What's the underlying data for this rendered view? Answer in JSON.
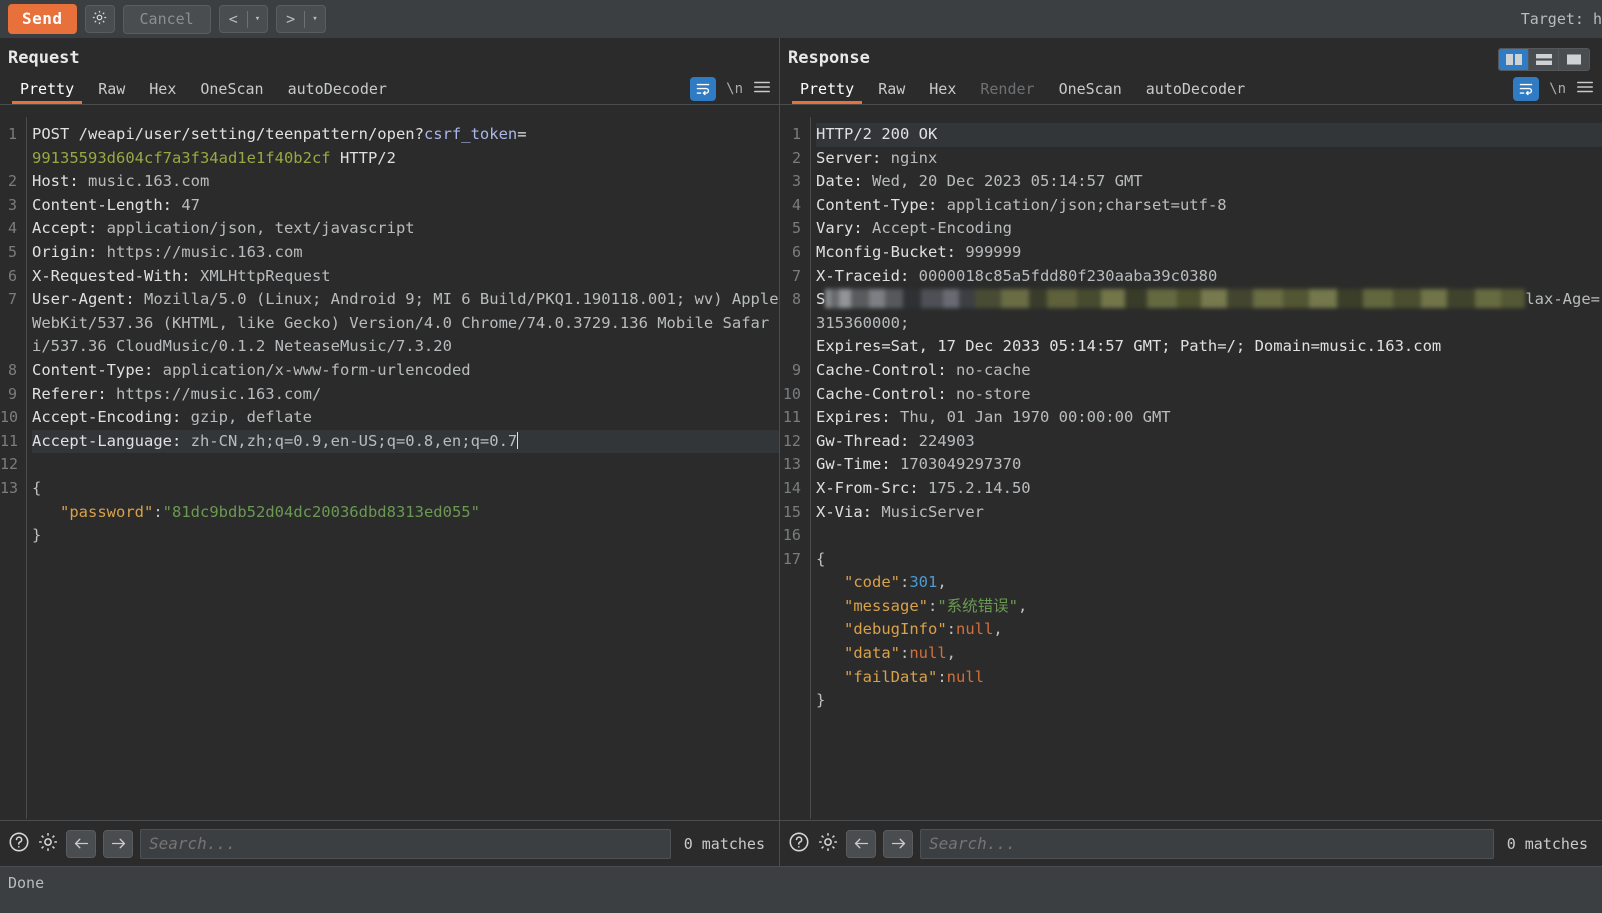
{
  "toolbar": {
    "send_label": "Send",
    "settings_icon": "gear-icon",
    "cancel_label": "Cancel",
    "prev_arrow": "<",
    "next_arrow": ">",
    "caret": "▾",
    "target_label": "Target: h"
  },
  "layout_switch": {
    "vertical_split": "vertical-split-icon",
    "horizontal_split": "horizontal-split-icon",
    "single_pane": "single-pane-icon",
    "active": "vertical_split",
    "active_color": "#2f7cc4"
  },
  "request": {
    "title": "Request",
    "tabs": [
      {
        "label": "Pretty",
        "active": true
      },
      {
        "label": "Raw",
        "active": false
      },
      {
        "label": "Hex",
        "active": false
      },
      {
        "label": "OneScan",
        "active": false
      },
      {
        "label": "autoDecoder",
        "active": false
      }
    ],
    "tools": {
      "wrap_icon": "word-wrap-icon",
      "wrap_active": true,
      "newline_label": "\\n",
      "menu_icon": "hamburger-menu-icon"
    },
    "line_numbers": [
      "1",
      "",
      "2",
      "3",
      "4",
      "5",
      "6",
      "7",
      "",
      "",
      "8",
      "9",
      "10",
      "11",
      "12",
      "13",
      "",
      ""
    ],
    "lines": [
      {
        "n": "1",
        "type": "request-line",
        "method": "POST",
        "path": "/weapi/user/setting/teenpattern/open?",
        "param": "csrf_token",
        "eq": "="
      },
      {
        "n": "",
        "type": "continuation",
        "token": "99135593d604cf7a3f34ad1e1f40b2cf",
        "proto": " HTTP/2"
      },
      {
        "n": "2",
        "type": "header",
        "name": "Host: ",
        "value": "music.163.com"
      },
      {
        "n": "3",
        "type": "header",
        "name": "Content-Length: ",
        "value": "47"
      },
      {
        "n": "4",
        "type": "header",
        "name": "Accept: ",
        "value": "application/json, text/javascript"
      },
      {
        "n": "5",
        "type": "header",
        "name": "Origin: ",
        "value": "https://music.163.com"
      },
      {
        "n": "6",
        "type": "header",
        "name": "X-Requested-With: ",
        "value": "XMLHttpRequest"
      },
      {
        "n": "7",
        "type": "header",
        "name": "User-Agent: ",
        "value": "Mozilla/5.0 (Linux; Android 9; MI 6 Build/PKQ1.190118.001; wv) AppleWebKit/537.36 (KHTML, like Gecko) Version/4.0 Chrome/74.0.3729.136 Mobile Safari/537.36 CloudMusic/0.1.2 NeteaseMusic/7.3.20"
      },
      {
        "n": "8",
        "type": "header",
        "name": "Content-Type: ",
        "value": "application/x-www-form-urlencoded"
      },
      {
        "n": "9",
        "type": "header",
        "name": "Referer: ",
        "value": "https://music.163.com/"
      },
      {
        "n": "10",
        "type": "header",
        "name": "Accept-Encoding: ",
        "value": "gzip, deflate"
      },
      {
        "n": "11",
        "type": "header",
        "name": "Accept-Language: ",
        "value": "zh-CN,zh;q=0.9,en-US;q=0.8,en;q=0.7",
        "highlighted": true,
        "caret": true
      },
      {
        "n": "12",
        "type": "blank"
      },
      {
        "n": "13",
        "type": "json-open",
        "text": "{"
      },
      {
        "n": "",
        "type": "json-pair",
        "key": "\"password\"",
        "colon": ":",
        "value": "\"81dc9bdb52d04dc20036dbd8313ed055\""
      },
      {
        "n": "",
        "type": "json-close",
        "text": "}"
      }
    ],
    "search": {
      "help_icon": "help-circle-icon",
      "settings_icon": "gear-icon",
      "back_icon": "arrow-left-icon",
      "forward_icon": "arrow-right-icon",
      "placeholder": "Search...",
      "value": "",
      "matches": "0 matches"
    }
  },
  "response": {
    "title": "Response",
    "tabs": [
      {
        "label": "Pretty",
        "active": true
      },
      {
        "label": "Raw",
        "active": false
      },
      {
        "label": "Hex",
        "active": false
      },
      {
        "label": "Render",
        "active": false,
        "disabled": true
      },
      {
        "label": "OneScan",
        "active": false
      },
      {
        "label": "autoDecoder",
        "active": false
      }
    ],
    "tools": {
      "wrap_icon": "word-wrap-icon",
      "wrap_active": true,
      "newline_label": "\\n",
      "menu_icon": "hamburger-menu-icon"
    },
    "lines": [
      {
        "n": "1",
        "type": "status-line",
        "text": "HTTP/2 200 OK",
        "highlighted": true
      },
      {
        "n": "2",
        "type": "header",
        "name": "Server: ",
        "value": "nginx"
      },
      {
        "n": "3",
        "type": "header",
        "name": "Date: ",
        "value": "Wed, 20 Dec 2023 05:14:57 GMT"
      },
      {
        "n": "4",
        "type": "header",
        "name": "Content-Type: ",
        "value": "application/json;charset=utf-8"
      },
      {
        "n": "5",
        "type": "header",
        "name": "Vary: ",
        "value": "Accept-Encoding"
      },
      {
        "n": "6",
        "type": "header",
        "name": "Mconfig-Bucket: ",
        "value": "999999"
      },
      {
        "n": "7",
        "type": "header",
        "name": "X-Traceid: ",
        "value": "0000018c85a5fdd80f230aaba39c0380"
      },
      {
        "n": "8",
        "type": "redacted-header",
        "prefix": "S",
        "redacted": true,
        "tail": "lax-Age=315360000;"
      },
      {
        "n": "",
        "type": "continuation",
        "text": "Expires=Sat, 17 Dec 2033 05:14:57 GMT; Path=/; Domain=music.163.com"
      },
      {
        "n": "9",
        "type": "header",
        "name": "Cache-Control: ",
        "value": "no-cache"
      },
      {
        "n": "10",
        "type": "header",
        "name": "Cache-Control: ",
        "value": "no-store"
      },
      {
        "n": "11",
        "type": "header",
        "name": "Expires: ",
        "value": "Thu, 01 Jan 1970 00:00:00 GMT"
      },
      {
        "n": "12",
        "type": "header",
        "name": "Gw-Thread: ",
        "value": "224903"
      },
      {
        "n": "13",
        "type": "header",
        "name": "Gw-Time: ",
        "value": "1703049297370"
      },
      {
        "n": "14",
        "type": "header",
        "name": "X-From-Src: ",
        "value": "175.2.14.50"
      },
      {
        "n": "15",
        "type": "header",
        "name": "X-Via: ",
        "value": "MusicServer"
      },
      {
        "n": "16",
        "type": "blank"
      },
      {
        "n": "17",
        "type": "json-open",
        "text": "{"
      },
      {
        "n": "",
        "type": "json-pair",
        "key": "\"code\"",
        "colon": ":",
        "value": "301",
        "vtype": "num",
        "comma": ","
      },
      {
        "n": "",
        "type": "json-pair",
        "key": "\"message\"",
        "colon": ":",
        "value": "\"系统错误\"",
        "vtype": "str",
        "comma": ","
      },
      {
        "n": "",
        "type": "json-pair",
        "key": "\"debugInfo\"",
        "colon": ":",
        "value": "null",
        "vtype": "nul",
        "comma": ","
      },
      {
        "n": "",
        "type": "json-pair",
        "key": "\"data\"",
        "colon": ":",
        "value": "null",
        "vtype": "nul",
        "comma": ","
      },
      {
        "n": "",
        "type": "json-pair",
        "key": "\"failData\"",
        "colon": ":",
        "value": "null",
        "vtype": "nul",
        "comma": ""
      },
      {
        "n": "",
        "type": "json-close",
        "text": "}"
      }
    ],
    "search": {
      "help_icon": "help-circle-icon",
      "settings_icon": "gear-icon",
      "back_icon": "arrow-left-icon",
      "forward_icon": "arrow-right-icon",
      "placeholder": "Search...",
      "value": "",
      "matches": "0 matches"
    }
  },
  "status": {
    "text": "Done"
  },
  "colors": {
    "accent": "#e8703a",
    "active_blue": "#2f7cc4",
    "background": "#2b2b2b",
    "chrome": "#3c3f41"
  }
}
